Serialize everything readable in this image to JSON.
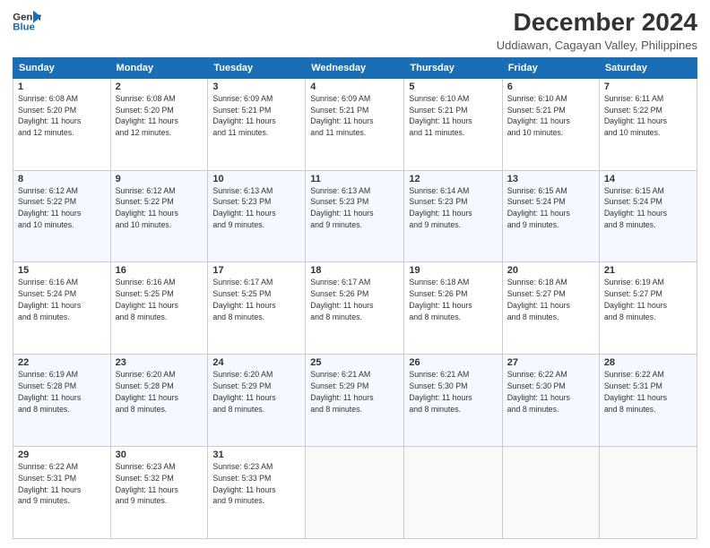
{
  "logo": {
    "line1": "General",
    "line2": "Blue"
  },
  "title": "December 2024",
  "location": "Uddiawan, Cagayan Valley, Philippines",
  "days_of_week": [
    "Sunday",
    "Monday",
    "Tuesday",
    "Wednesday",
    "Thursday",
    "Friday",
    "Saturday"
  ],
  "weeks": [
    [
      {
        "day": "1",
        "info": "Sunrise: 6:08 AM\nSunset: 5:20 PM\nDaylight: 11 hours\nand 12 minutes."
      },
      {
        "day": "2",
        "info": "Sunrise: 6:08 AM\nSunset: 5:20 PM\nDaylight: 11 hours\nand 12 minutes."
      },
      {
        "day": "3",
        "info": "Sunrise: 6:09 AM\nSunset: 5:21 PM\nDaylight: 11 hours\nand 11 minutes."
      },
      {
        "day": "4",
        "info": "Sunrise: 6:09 AM\nSunset: 5:21 PM\nDaylight: 11 hours\nand 11 minutes."
      },
      {
        "day": "5",
        "info": "Sunrise: 6:10 AM\nSunset: 5:21 PM\nDaylight: 11 hours\nand 11 minutes."
      },
      {
        "day": "6",
        "info": "Sunrise: 6:10 AM\nSunset: 5:21 PM\nDaylight: 11 hours\nand 10 minutes."
      },
      {
        "day": "7",
        "info": "Sunrise: 6:11 AM\nSunset: 5:22 PM\nDaylight: 11 hours\nand 10 minutes."
      }
    ],
    [
      {
        "day": "8",
        "info": "Sunrise: 6:12 AM\nSunset: 5:22 PM\nDaylight: 11 hours\nand 10 minutes."
      },
      {
        "day": "9",
        "info": "Sunrise: 6:12 AM\nSunset: 5:22 PM\nDaylight: 11 hours\nand 10 minutes."
      },
      {
        "day": "10",
        "info": "Sunrise: 6:13 AM\nSunset: 5:23 PM\nDaylight: 11 hours\nand 9 minutes."
      },
      {
        "day": "11",
        "info": "Sunrise: 6:13 AM\nSunset: 5:23 PM\nDaylight: 11 hours\nand 9 minutes."
      },
      {
        "day": "12",
        "info": "Sunrise: 6:14 AM\nSunset: 5:23 PM\nDaylight: 11 hours\nand 9 minutes."
      },
      {
        "day": "13",
        "info": "Sunrise: 6:15 AM\nSunset: 5:24 PM\nDaylight: 11 hours\nand 9 minutes."
      },
      {
        "day": "14",
        "info": "Sunrise: 6:15 AM\nSunset: 5:24 PM\nDaylight: 11 hours\nand 8 minutes."
      }
    ],
    [
      {
        "day": "15",
        "info": "Sunrise: 6:16 AM\nSunset: 5:24 PM\nDaylight: 11 hours\nand 8 minutes."
      },
      {
        "day": "16",
        "info": "Sunrise: 6:16 AM\nSunset: 5:25 PM\nDaylight: 11 hours\nand 8 minutes."
      },
      {
        "day": "17",
        "info": "Sunrise: 6:17 AM\nSunset: 5:25 PM\nDaylight: 11 hours\nand 8 minutes."
      },
      {
        "day": "18",
        "info": "Sunrise: 6:17 AM\nSunset: 5:26 PM\nDaylight: 11 hours\nand 8 minutes."
      },
      {
        "day": "19",
        "info": "Sunrise: 6:18 AM\nSunset: 5:26 PM\nDaylight: 11 hours\nand 8 minutes."
      },
      {
        "day": "20",
        "info": "Sunrise: 6:18 AM\nSunset: 5:27 PM\nDaylight: 11 hours\nand 8 minutes."
      },
      {
        "day": "21",
        "info": "Sunrise: 6:19 AM\nSunset: 5:27 PM\nDaylight: 11 hours\nand 8 minutes."
      }
    ],
    [
      {
        "day": "22",
        "info": "Sunrise: 6:19 AM\nSunset: 5:28 PM\nDaylight: 11 hours\nand 8 minutes."
      },
      {
        "day": "23",
        "info": "Sunrise: 6:20 AM\nSunset: 5:28 PM\nDaylight: 11 hours\nand 8 minutes."
      },
      {
        "day": "24",
        "info": "Sunrise: 6:20 AM\nSunset: 5:29 PM\nDaylight: 11 hours\nand 8 minutes."
      },
      {
        "day": "25",
        "info": "Sunrise: 6:21 AM\nSunset: 5:29 PM\nDaylight: 11 hours\nand 8 minutes."
      },
      {
        "day": "26",
        "info": "Sunrise: 6:21 AM\nSunset: 5:30 PM\nDaylight: 11 hours\nand 8 minutes."
      },
      {
        "day": "27",
        "info": "Sunrise: 6:22 AM\nSunset: 5:30 PM\nDaylight: 11 hours\nand 8 minutes."
      },
      {
        "day": "28",
        "info": "Sunrise: 6:22 AM\nSunset: 5:31 PM\nDaylight: 11 hours\nand 8 minutes."
      }
    ],
    [
      {
        "day": "29",
        "info": "Sunrise: 6:22 AM\nSunset: 5:31 PM\nDaylight: 11 hours\nand 9 minutes."
      },
      {
        "day": "30",
        "info": "Sunrise: 6:23 AM\nSunset: 5:32 PM\nDaylight: 11 hours\nand 9 minutes."
      },
      {
        "day": "31",
        "info": "Sunrise: 6:23 AM\nSunset: 5:33 PM\nDaylight: 11 hours\nand 9 minutes."
      },
      {
        "day": "",
        "info": ""
      },
      {
        "day": "",
        "info": ""
      },
      {
        "day": "",
        "info": ""
      },
      {
        "day": "",
        "info": ""
      }
    ]
  ]
}
